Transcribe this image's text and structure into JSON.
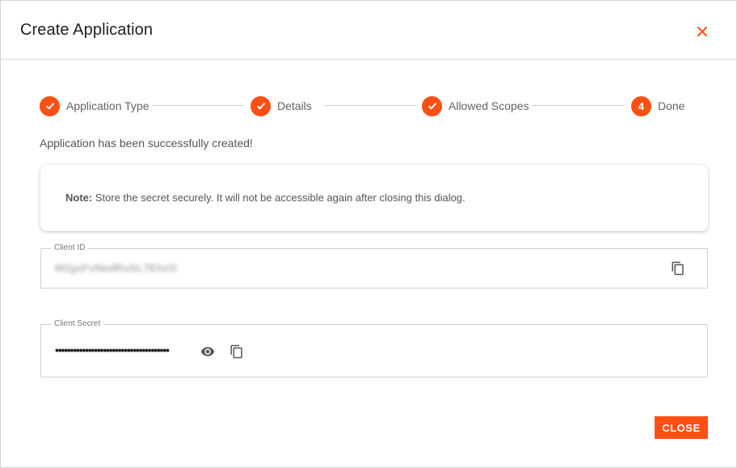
{
  "dialog": {
    "title": "Create Application",
    "close_icon": "close-icon"
  },
  "stepper": {
    "steps": [
      {
        "label": "Application Type",
        "state": "completed",
        "icon": "check-icon"
      },
      {
        "label": "Details",
        "state": "completed",
        "icon": "check-icon"
      },
      {
        "label": "Allowed Scopes",
        "state": "completed",
        "icon": "check-icon"
      },
      {
        "label": "Done",
        "state": "active",
        "number": "4"
      }
    ]
  },
  "message": "Application has been successfully created!",
  "note": {
    "prefix": "Note:",
    "text": " Store the secret securely. It will not be accessible again after closing this dialog."
  },
  "client_id": {
    "label": "Client ID",
    "value": "M2gxFvNedRuSL7EhzG",
    "copy_icon": "copy-icon"
  },
  "client_secret": {
    "label": "Client Secret",
    "value": "••••••••••••••••••••••••••••••••••••••",
    "visibility_icon": "eye-icon",
    "copy_icon": "copy-icon"
  },
  "actions": {
    "close_label": "CLOSE"
  },
  "colors": {
    "accent": "#ff4f12",
    "border": "#cfcfcf",
    "text_muted": "#5f6368"
  }
}
